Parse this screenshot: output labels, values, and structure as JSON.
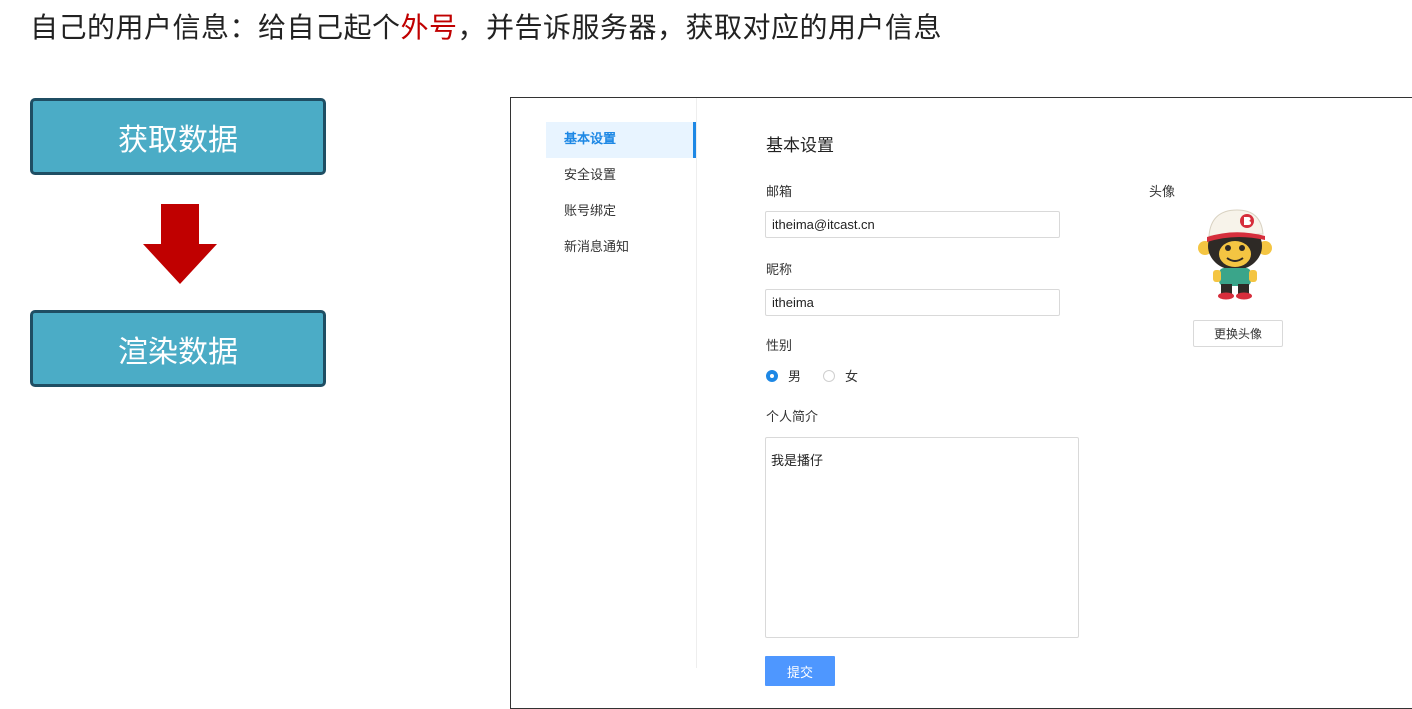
{
  "heading": {
    "before": "自己的用户信息：给自己起个",
    "highlight": "外号",
    "after": "，并告诉服务器，获取对应的用户信息"
  },
  "flow": {
    "step1": "获取数据",
    "step2": "渲染数据",
    "arrow_color": "#c00000",
    "box_color": "#4bacc6"
  },
  "settings": {
    "menu": [
      "基本设置",
      "安全设置",
      "账号绑定",
      "新消息通知"
    ],
    "active_menu": "基本设置",
    "title": "基本设置",
    "email_label": "邮箱",
    "email_value": "itheima@itcast.cn",
    "nickname_label": "昵称",
    "nickname_value": "itheima",
    "gender_label": "性别",
    "gender_options": [
      "男",
      "女"
    ],
    "gender_selected": "男",
    "bio_label": "个人简介",
    "bio_value": "我是播仔",
    "submit_label": "提交",
    "avatar_label": "头像",
    "avatar_icon": "monkey-avatar-icon",
    "change_avatar_label": "更换头像",
    "accent_color": "#1e88e5",
    "submit_color": "#4e97ff"
  }
}
